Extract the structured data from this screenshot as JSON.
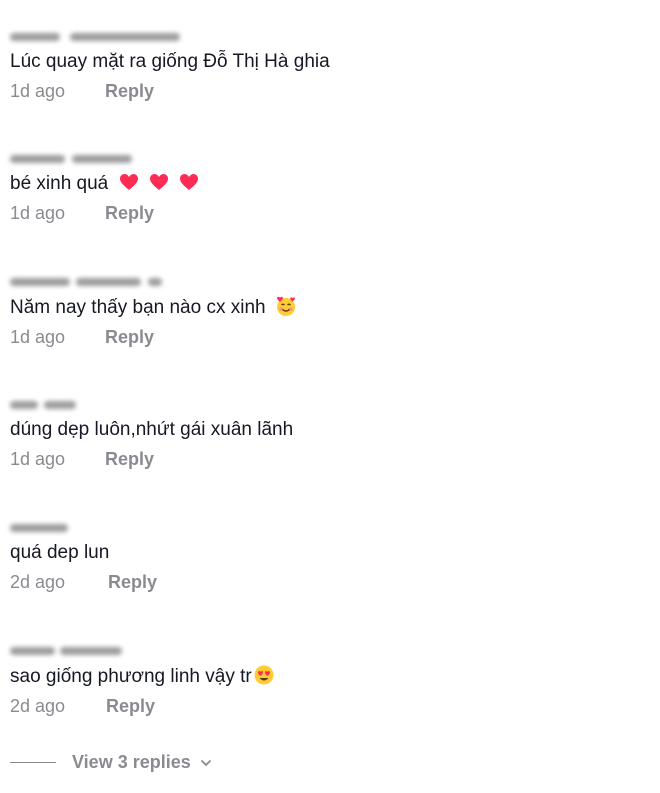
{
  "comments": [
    {
      "text": "Lúc quay mặt ra giống Đỗ Thị Hà ghia",
      "time": "1d ago",
      "reply_label": "Reply",
      "emojis": []
    },
    {
      "text": "bé xinh quá",
      "time": "1d ago",
      "reply_label": "Reply",
      "emojis": [
        "heart-icon",
        "heart-icon",
        "heart-icon"
      ]
    },
    {
      "text": "Năm nay thấy bạn nào cx xinh",
      "time": "1d ago",
      "reply_label": "Reply",
      "emojis": [
        "smiling-face-with-hearts-icon"
      ]
    },
    {
      "text": "dúng dẹp luôn,nhứt gái xuân lãnh",
      "time": "1d ago",
      "reply_label": "Reply",
      "emojis": []
    },
    {
      "text": "quá dep lun",
      "time": "2d ago",
      "reply_label": "Reply",
      "emojis": []
    },
    {
      "text": "sao giống phương linh vậy tr",
      "time": "2d ago",
      "reply_label": "Reply",
      "emojis": [
        "heart-eyes-icon"
      ]
    }
  ],
  "view_replies_label": "View 3 replies",
  "colors": {
    "text": "#161823",
    "muted": "#8a8b91",
    "heart": "#fe2c55",
    "emoji_face": "#ffcc33"
  }
}
